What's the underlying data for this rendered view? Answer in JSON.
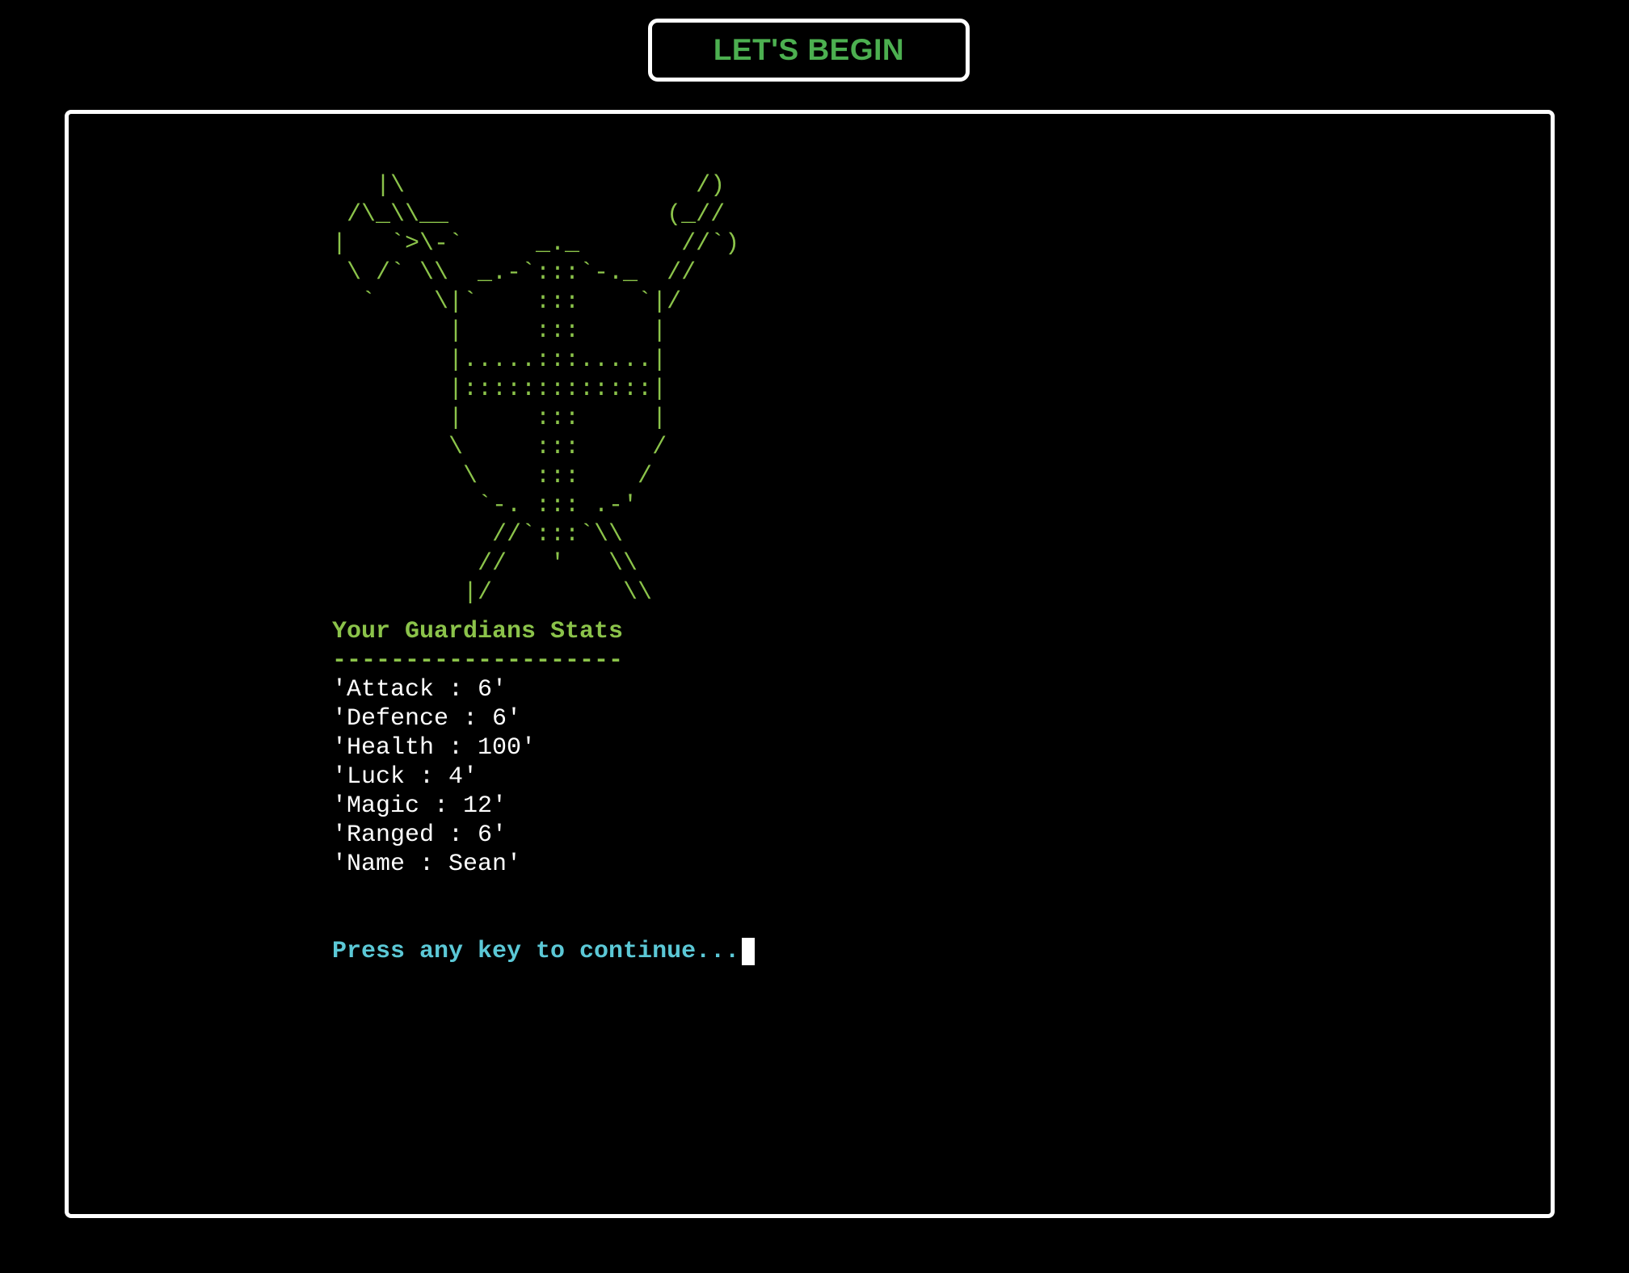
{
  "header": {
    "begin_button_label": "LET'S BEGIN"
  },
  "terminal": {
    "ascii_art": "   |\\                    /)\n /\\_\\\\__               (_//\n|   `>\\-`     _._       //`)\n \\ /` \\\\  _.-`:::`-._  //\n  `    \\|`    :::    `|/\n        |     :::     |\n        |.....:::.....|\n        |:::::::::::::|\n        |     :::     |\n        \\     :::     /\n         \\    :::    /\n          `-. ::: .-'\n           //`:::`\\\\\n          //   '   \\\\\n         |/         \\\\",
    "stats_title": "Your Guardians Stats",
    "stats_divider": "--------------------",
    "stats": [
      "'Attack : 6'",
      "'Defence : 6'",
      "'Health : 100'",
      "'Luck : 4'",
      "'Magic : 12'",
      "'Ranged : 6'",
      "'Name : Sean'"
    ],
    "prompt": "Press any key to continue..."
  },
  "colors": {
    "background": "#000000",
    "border": "#ffffff",
    "button_text": "#4caf50",
    "art_green": "#8bc34a",
    "prompt_cyan": "#5bc8d6",
    "stat_text": "#ffffff"
  }
}
